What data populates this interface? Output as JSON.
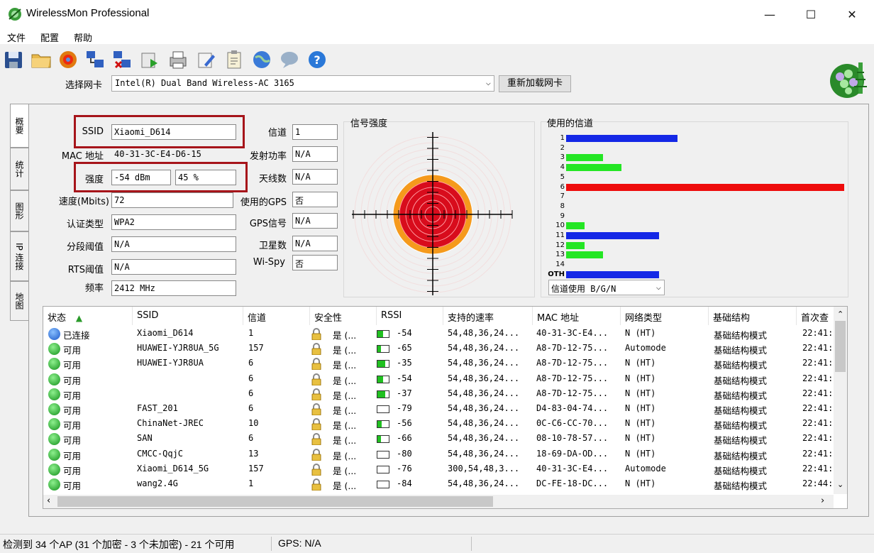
{
  "window": {
    "title": "WirelessMon Professional",
    "minimize": "—",
    "maximize": "☐",
    "close": "✕"
  },
  "menu": [
    "文件",
    "配置",
    "帮助"
  ],
  "toolbar": [
    "save-icon",
    "open-folder-icon",
    "record-icon",
    "connect-icon",
    "disconnect-icon",
    "export-icon",
    "print-icon",
    "edit-icon",
    "clipboard-icon",
    "globe-icon",
    "chat-icon",
    "help-icon"
  ],
  "adapter": {
    "label": "选择网卡",
    "value": "Intel(R) Dual Band Wireless-AC 3165",
    "reload": "重新加载网卡"
  },
  "tabs": [
    "概要",
    "统计",
    "图形",
    "IP 连接",
    "地图"
  ],
  "summary": {
    "ssid_label": "SSID",
    "ssid": "Xiaomi_D614",
    "mac_label": "MAC 地址",
    "mac": "40-31-3C-E4-D6-15",
    "strength_label": "强度",
    "strength_dbm": "-54 dBm",
    "strength_pct": "45 %",
    "speed_label": "速度(Mbits)",
    "speed": "72",
    "auth_label": "认证类型",
    "auth": "WPA2",
    "frag_label": "分段阈值",
    "frag": "N/A",
    "rts_label": "RTS阈值",
    "rts": "N/A",
    "freq_label": "频率",
    "freq": "2412 MHz",
    "channel_label": "信道",
    "channel": "1",
    "txpower_label": "发射功率",
    "txpower": "N/A",
    "antenna_label": "天线数",
    "antenna": "N/A",
    "gps_label": "使用的GPS",
    "gps": "否",
    "gpssig_label": "GPS信号",
    "gpssig": "N/A",
    "sat_label": "卫星数",
    "sat": "N/A",
    "wispy_label": "Wi-Spy",
    "wispy": "否"
  },
  "signal": {
    "title": "信号强度"
  },
  "channels": {
    "title": "使用的信道",
    "select": "信道使用 B/G/N",
    "labels": [
      "1",
      "2",
      "3",
      "4",
      "5",
      "6",
      "7",
      "8",
      "9",
      "10",
      "11",
      "12",
      "13",
      "14",
      "OTH"
    ],
    "usage": [
      6,
      0,
      2,
      3,
      0,
      15,
      0,
      0,
      0,
      1,
      5,
      1,
      2,
      0,
      5
    ],
    "colors": [
      "#1428e6",
      "#1428e6",
      "#24e624",
      "#24e624",
      "#24e624",
      "#ee0c0c",
      "#24e624",
      "#24e624",
      "#24e624",
      "#24e624",
      "#1428e6",
      "#24e624",
      "#24e624",
      "#24e624",
      "#1428e6"
    ]
  },
  "columns": [
    "状态",
    "SSID",
    "信道",
    "安全性",
    "RSSI",
    "支持的速率",
    "MAC 地址",
    "网络类型",
    "基础结构",
    "首次查"
  ],
  "rows": [
    {
      "status": "已连接",
      "ssid": "Xiaomi_D614",
      "ch": "1",
      "sec": "是 (...",
      "rssi": "-54",
      "lvl": 0.5,
      "rates": "54,48,36,24...",
      "mac": "40-31-3C-E4...",
      "type": "N (HT)",
      "infra": "基础结构模式",
      "first": "22:41:",
      "connected": true
    },
    {
      "status": "可用",
      "ssid": "HUAWEI-YJR8UA_5G",
      "ch": "157",
      "sec": "是 (...",
      "rssi": "-65",
      "lvl": 0.3,
      "rates": "54,48,36,24...",
      "mac": "A8-7D-12-75...",
      "type": "Automode",
      "infra": "基础结构模式",
      "first": "22:41:"
    },
    {
      "status": "可用",
      "ssid": "HUAWEI-YJR8UA",
      "ch": "6",
      "sec": "是 (...",
      "rssi": "-35",
      "lvl": 0.7,
      "rates": "54,48,36,24...",
      "mac": "A8-7D-12-75...",
      "type": "N (HT)",
      "infra": "基础结构模式",
      "first": "22:41:"
    },
    {
      "status": "可用",
      "ssid": "",
      "ch": "6",
      "sec": "是 (...",
      "rssi": "-54",
      "lvl": 0.5,
      "rates": "54,48,36,24...",
      "mac": "A8-7D-12-75...",
      "type": "N (HT)",
      "infra": "基础结构模式",
      "first": "22:41:"
    },
    {
      "status": "可用",
      "ssid": "",
      "ch": "6",
      "sec": "是 (...",
      "rssi": "-37",
      "lvl": 0.7,
      "rates": "54,48,36,24...",
      "mac": "A8-7D-12-75...",
      "type": "N (HT)",
      "infra": "基础结构模式",
      "first": "22:41:"
    },
    {
      "status": "可用",
      "ssid": "FAST_201",
      "ch": "6",
      "sec": "是 (...",
      "rssi": "-79",
      "lvl": 0,
      "rates": "54,48,36,24...",
      "mac": "D4-83-04-74...",
      "type": "N (HT)",
      "infra": "基础结构模式",
      "first": "22:41:"
    },
    {
      "status": "可用",
      "ssid": "ChinaNet-JREC",
      "ch": "10",
      "sec": "是 (...",
      "rssi": "-56",
      "lvl": 0.4,
      "rates": "54,48,36,24...",
      "mac": "0C-C6-CC-70...",
      "type": "N (HT)",
      "infra": "基础结构模式",
      "first": "22:41:"
    },
    {
      "status": "可用",
      "ssid": "SAN",
      "ch": "6",
      "sec": "是 (...",
      "rssi": "-66",
      "lvl": 0.3,
      "rates": "54,48,36,24...",
      "mac": "08-10-78-57...",
      "type": "N (HT)",
      "infra": "基础结构模式",
      "first": "22:41:"
    },
    {
      "status": "可用",
      "ssid": "CMCC-QqjC",
      "ch": "13",
      "sec": "是 (...",
      "rssi": "-80",
      "lvl": 0,
      "rates": "54,48,36,24...",
      "mac": "18-69-DA-OD...",
      "type": "N (HT)",
      "infra": "基础结构模式",
      "first": "22:41:"
    },
    {
      "status": "可用",
      "ssid": "Xiaomi_D614_5G",
      "ch": "157",
      "sec": "是 (...",
      "rssi": "-76",
      "lvl": 0,
      "rates": "300,54,48,3...",
      "mac": "40-31-3C-E4...",
      "type": "Automode",
      "infra": "基础结构模式",
      "first": "22:41:"
    },
    {
      "status": "可用",
      "ssid": "wang2.4G",
      "ch": "1",
      "sec": "是 (...",
      "rssi": "-84",
      "lvl": 0,
      "rates": "54,48,36,24...",
      "mac": "DC-FE-18-DC...",
      "type": "N (HT)",
      "infra": "基础结构模式",
      "first": "22:44:"
    }
  ],
  "status": {
    "summary": "检测到 34 个AP (31 个加密 - 3 个未加密) - 21 个可用",
    "gps": "GPS: N/A"
  }
}
